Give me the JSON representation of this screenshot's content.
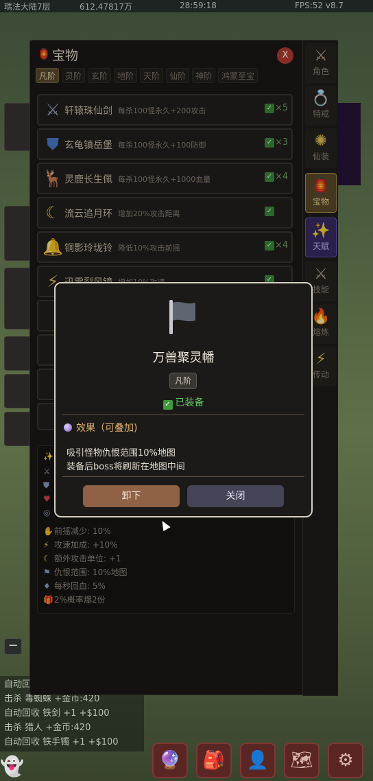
{
  "topbar": {
    "left": "瑪法大陆7层",
    "gold": "612.47817万",
    "timer": "28:59:18",
    "fps": "FPS:52 v8.7"
  },
  "panel": {
    "title": "宝物",
    "close_label": "X",
    "tabs": [
      "凡阶",
      "灵阶",
      "玄阶",
      "地阶",
      "天阶",
      "仙阶",
      "神阶",
      "鸿蒙至宝"
    ],
    "active_tab": "凡阶"
  },
  "items": [
    {
      "name": "轩辕珠仙剑",
      "desc": "每杀100怪永久+200攻击",
      "count": "×5",
      "icon": "crossed-swords-icon"
    },
    {
      "name": "玄龟镇岳堡",
      "desc": "每杀100怪永久+100防御",
      "count": "×3",
      "icon": "shield-icon"
    },
    {
      "name": "灵鹿长生佩",
      "desc": "每杀100怪永久+1000血量",
      "count": "×4",
      "icon": "deer-icon"
    },
    {
      "name": "流云追月环",
      "desc": "增加20%攻击距离",
      "count": "",
      "icon": "moon-icon"
    },
    {
      "name": "铜影玲珑铃",
      "desc": "降低10%攻击前摇",
      "count": "×4",
      "icon": "bell-icon"
    },
    {
      "name": "迅雷裂风镜",
      "desc": "增加10%攻速",
      "count": "",
      "icon": "lightning-icon"
    }
  ],
  "stats": [
    {
      "icon": "sparkle-icon",
      "text": "✦"
    },
    {
      "icon": "sword-icon",
      "text": ""
    },
    {
      "icon": "shield-icon",
      "text": ""
    },
    {
      "icon": "heart-icon",
      "text": ""
    },
    {
      "icon": "target-icon",
      "text": ""
    },
    {
      "icon": "hand-icon",
      "text": "前摇减少: 10%"
    },
    {
      "icon": "lightning-icon",
      "text": "攻速加成: +10%"
    },
    {
      "icon": "moon-icon",
      "text": "额外攻击单位: +1"
    },
    {
      "icon": "flag-icon",
      "text": "仇恨范围: 10%地图"
    },
    {
      "icon": "gem-icon",
      "text": "每秒回血: 5%"
    },
    {
      "icon": "gift-icon",
      "text": "2%概率爆2份"
    }
  ],
  "side_tabs": [
    {
      "label": "角色",
      "icon": "crossed-swords-icon",
      "state": "normal"
    },
    {
      "label": "特戒",
      "icon": "ring-icon",
      "state": "normal"
    },
    {
      "label": "仙装",
      "icon": "sun-icon",
      "state": "normal"
    },
    {
      "label": "宝物",
      "icon": "lantern-icon",
      "state": "active"
    },
    {
      "label": "天赋",
      "icon": "star-icon",
      "state": "special"
    },
    {
      "label": "技能",
      "icon": "swords-icon",
      "state": "normal"
    },
    {
      "label": "熔炼",
      "icon": "flame-icon",
      "state": "normal"
    },
    {
      "label": "传动",
      "icon": "lightning-icon",
      "state": "normal"
    }
  ],
  "modal": {
    "title": "万兽聚灵幡",
    "rarity": "凡阶",
    "equipped_label": "已装备",
    "effect_title": "效果（可叠加)",
    "effect_lines": [
      "吸引怪物仇恨范围10%地图",
      "装备后boss将刷新在地图中间"
    ],
    "unequip_label": "卸下",
    "close_label": "关闭"
  },
  "log": [
    "自动回收",
    "击杀 毒蜘蛛 +金币:420",
    "自动回收 铁剑 +1 +$100",
    "击杀 猎人 +金币:420",
    "自动回收 铁手镯 +1 +$100"
  ],
  "bottom_nav": [
    "crystal-ball-icon",
    "backpack-icon",
    "person-icon",
    "map-icon",
    "gear-icon"
  ]
}
